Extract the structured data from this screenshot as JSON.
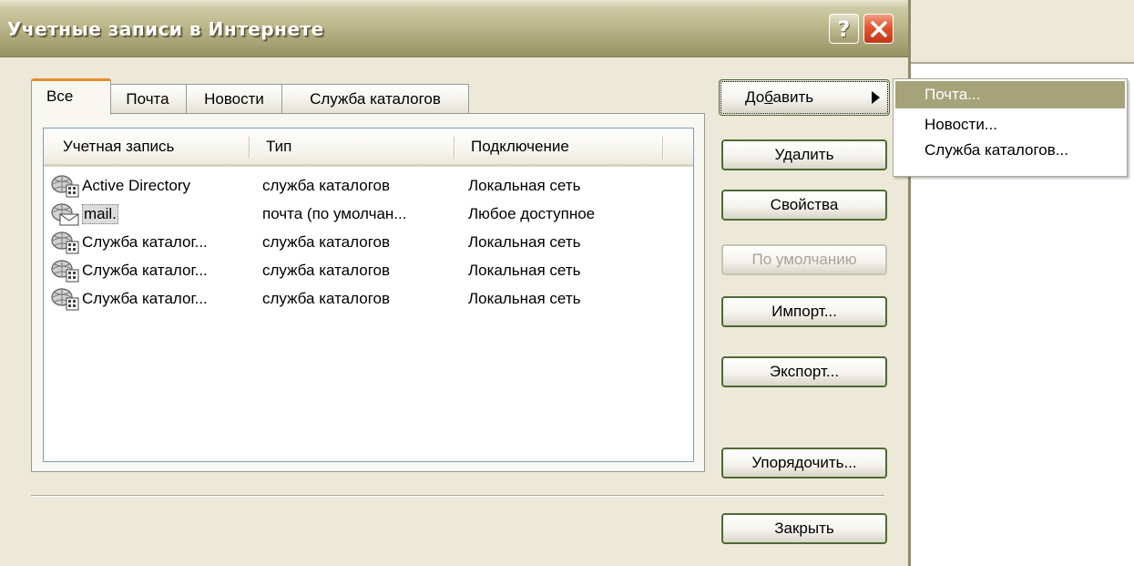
{
  "window": {
    "title": "Учетные записи в Интернете",
    "help_glyph": "?",
    "close_icon": "close-icon"
  },
  "tabs": [
    {
      "label": "Все",
      "active": true
    },
    {
      "label": "Почта",
      "active": false
    },
    {
      "label": "Новости",
      "active": false
    },
    {
      "label": "Служба каталогов",
      "active": false
    }
  ],
  "list": {
    "columns": [
      "Учетная запись",
      "Тип",
      "Подключение"
    ],
    "rows": [
      {
        "account": "Active Directory",
        "type": "служба каталогов",
        "connection": "Локальная сеть",
        "icon": "directory-service-icon",
        "selected": false
      },
      {
        "account": "mail.",
        "type": "почта (по умолчан...",
        "connection": "Любое доступное",
        "icon": "mail-account-icon",
        "selected": true
      },
      {
        "account": "Служба каталог...",
        "type": "служба каталогов",
        "connection": "Локальная сеть",
        "icon": "directory-service-icon",
        "selected": false
      },
      {
        "account": "Служба каталог...",
        "type": "служба каталогов",
        "connection": "Локальная сеть",
        "icon": "directory-service-icon",
        "selected": false
      },
      {
        "account": "Служба каталог...",
        "type": "служба каталогов",
        "connection": "Локальная сеть",
        "icon": "directory-service-icon",
        "selected": false
      }
    ]
  },
  "buttons": {
    "add_pre": "До",
    "add_accel": "б",
    "add_post": "авить",
    "delete": "Удалить",
    "properties": "Свойства",
    "set_default": "По умолчанию",
    "import": "Импорт...",
    "export": "Экспорт...",
    "order": "Упорядочить...",
    "close": "Закрыть"
  },
  "add_menu": {
    "items": [
      "Почта...",
      "Новости...",
      "Служба каталогов..."
    ],
    "highlighted_index": 0
  },
  "colors": {
    "titlebar": "#aaa67a",
    "dialog_bg": "#ece9d8",
    "active_tab_accent": "#e68b2c",
    "menu_highlight": "#a6a37b",
    "close_button": "#e2552e"
  }
}
